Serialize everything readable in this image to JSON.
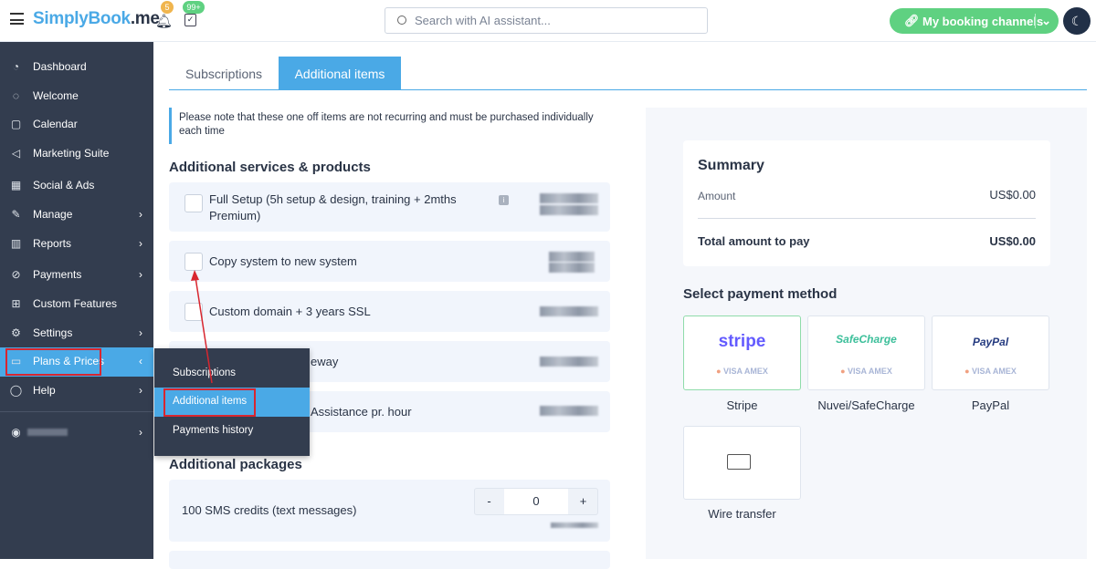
{
  "header": {
    "logo_main": "SimplyBook",
    "logo_suffix": ".me",
    "notif_count": "5",
    "tasks_count": "99+",
    "search_placeholder": "Search with AI assistant...",
    "booking_channels": "My booking channels"
  },
  "sidebar": {
    "items": [
      {
        "label": "Dashboard",
        "icon": "gauge-icon"
      },
      {
        "label": "Welcome",
        "icon": "lightbulb-icon"
      },
      {
        "label": "Calendar",
        "icon": "calendar-icon"
      },
      {
        "label": "Marketing Suite",
        "icon": "megaphone-icon"
      },
      {
        "label": "Social & Ads",
        "icon": "social-icon"
      },
      {
        "label": "Manage",
        "icon": "pencil-icon"
      },
      {
        "label": "Reports",
        "icon": "chart-icon"
      },
      {
        "label": "Payments",
        "icon": "payments-icon"
      },
      {
        "label": "Custom Features",
        "icon": "gift-icon"
      },
      {
        "label": "Settings",
        "icon": "gear-icon"
      },
      {
        "label": "Plans & Prices",
        "icon": "money-icon"
      },
      {
        "label": "Help",
        "icon": "chat-icon"
      }
    ]
  },
  "submenu": {
    "items": [
      "Subscriptions",
      "Additional items",
      "Payments history"
    ]
  },
  "tabs": [
    "Subscriptions",
    "Additional items"
  ],
  "note": "Please note that these one off items are not recurring and must be purchased individually each time",
  "services": {
    "title": "Additional services & products",
    "items": [
      "Full Setup (5h setup & design, training + 2mths Premium)",
      "Copy system to new system",
      "Custom domain + 3 years SSL",
      "eway",
      "Assistance pr. hour"
    ]
  },
  "packages": {
    "title": "Additional packages",
    "items": [
      {
        "label": "100 SMS credits (text messages)",
        "qty": "0",
        "minus": "-",
        "plus": "+"
      }
    ]
  },
  "summary": {
    "title": "Summary",
    "amount_label": "Amount",
    "amount": "US$0.00",
    "total_label": "Total amount to pay",
    "total": "US$0.00"
  },
  "payment": {
    "title": "Select payment method",
    "methods": [
      {
        "brand": "stripe",
        "label": "Stripe"
      },
      {
        "brand": "SafeCharge",
        "label": "Nuvei/SafeCharge"
      },
      {
        "brand": "PayPal",
        "label": "PayPal"
      },
      {
        "brand": "",
        "label": "Wire transfer"
      }
    ],
    "card_logos": "VISA AMEX"
  },
  "colors": {
    "accent": "#4aa9e6",
    "sidebar": "#333d4f",
    "green": "#5fd181",
    "highlight": "#d8262f"
  }
}
